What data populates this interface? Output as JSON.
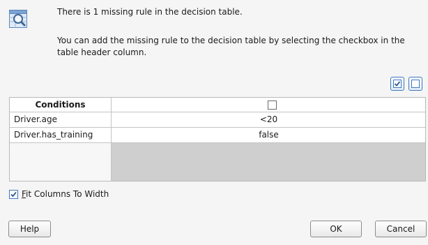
{
  "message": {
    "line1": "There is 1 missing rule in the decision table.",
    "line2": "You can add the missing rule to the decision table by selecting the checkbox in the table header column."
  },
  "icons": {
    "message_icon": "decision-table-search-icon",
    "select_all": "check-all-icon",
    "select_none": "uncheck-all-icon"
  },
  "table": {
    "header": "Conditions",
    "rows": [
      {
        "name": "Driver.age",
        "value": "<20"
      },
      {
        "name": "Driver.has_training",
        "value": "false"
      }
    ]
  },
  "fit_columns": {
    "label_rest": "it Columns To Width",
    "mnemonic": "F",
    "checked": true
  },
  "buttons": {
    "help": "Help",
    "ok": "OK",
    "cancel": "Cancel"
  },
  "colors": {
    "accent": "#3d79bf",
    "dialog_bg": "#f5f5f5",
    "grid_empty": "#cfcfcf"
  }
}
